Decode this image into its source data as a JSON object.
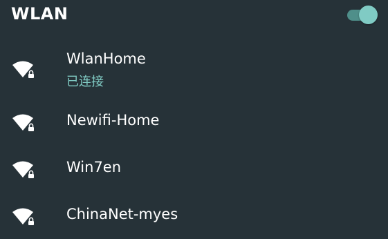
{
  "header": {
    "title": "WLAN",
    "wlan_enabled": true
  },
  "colors": {
    "background": "#263238",
    "accent": "#80cbc4",
    "toggle_track": "#4f8f8a",
    "text_primary": "#ffffff",
    "icon": "#ffffff"
  },
  "networks": [
    {
      "name": "WlanHome",
      "status": "已连接",
      "icon": "wifi-lock-icon",
      "secured": true
    },
    {
      "name": "Newifi-Home",
      "status": "",
      "icon": "wifi-lock-icon",
      "secured": true
    },
    {
      "name": "Win7en",
      "status": "",
      "icon": "wifi-lock-icon",
      "secured": true
    },
    {
      "name": "ChinaNet-myes",
      "status": "",
      "icon": "wifi-lock-icon",
      "secured": true
    }
  ]
}
